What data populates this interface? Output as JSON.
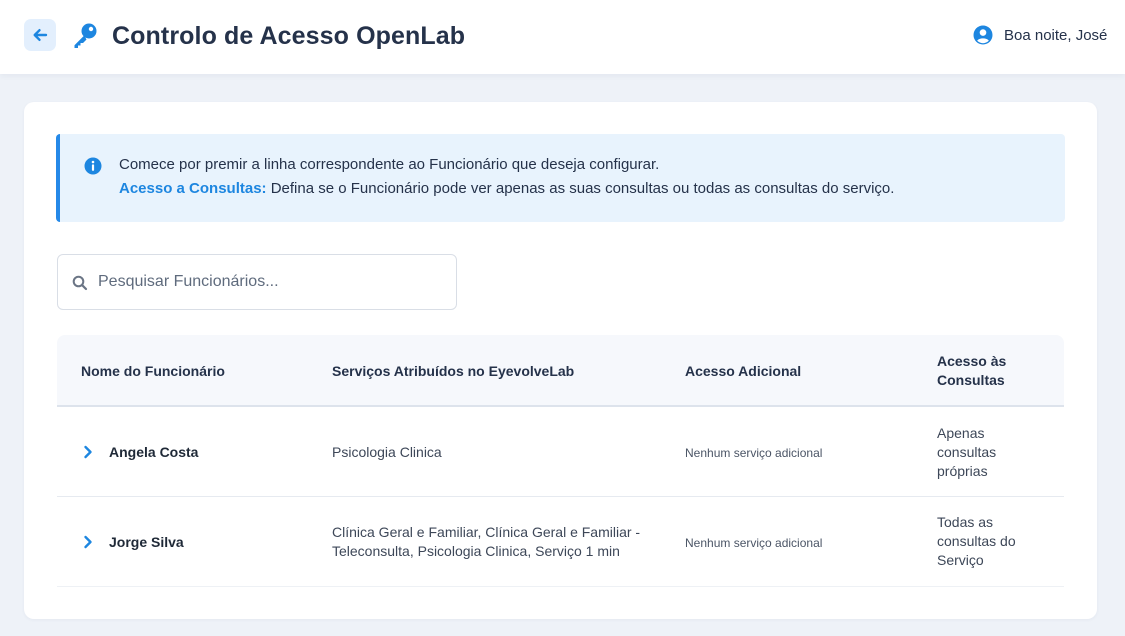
{
  "header": {
    "title": "Controlo de Acesso OpenLab",
    "greeting": "Boa noite, José",
    "icons": {
      "back": "arrow-left-icon",
      "app": "key-icon",
      "user": "user-circle-icon"
    }
  },
  "info": {
    "line1": "Comece por premir a linha correspondente ao Funcionário que deseja configurar.",
    "label": "Acesso a Consultas:",
    "line2": " Defina se o Funcionário pode ver apenas as suas consultas ou todas as consultas do serviço."
  },
  "search": {
    "placeholder": "Pesquisar Funcionários..."
  },
  "table": {
    "headers": {
      "name": "Nome do Funcionário",
      "services": "Serviços Atribuídos no EyevolveLab",
      "extra": "Acesso Adicional",
      "access_line1": "Acesso às",
      "access_line2": "Consultas"
    },
    "rows": [
      {
        "name": "Angela Costa",
        "services_line1": "Psicologia Clinica",
        "services_line2": "",
        "extra": "Nenhum serviço adicional",
        "access_line1": "Apenas",
        "access_line2": "consultas",
        "access_line3": "próprias"
      },
      {
        "name": "Jorge Silva",
        "services_line1": "Clínica Geral e Familiar, Clínica Geral e Familiar -",
        "services_line2": "Teleconsulta, Psicologia Clinica, Serviço 1 min",
        "extra": "Nenhum serviço adicional",
        "access_line1": "Todas as",
        "access_line2": "consultas do",
        "access_line3": "Serviço"
      }
    ]
  },
  "colors": {
    "accent": "#1d86e0",
    "background": "#eef2f8",
    "info_bg": "#e8f3fd"
  }
}
